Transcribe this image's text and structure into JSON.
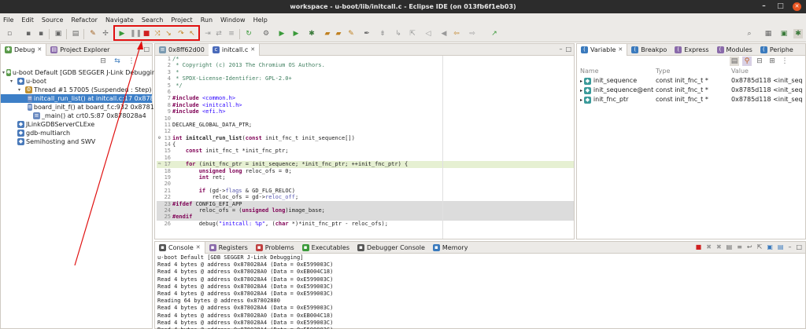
{
  "window": {
    "title": "workspace - u-boot/lib/initcall.c - Eclipse IDE  (on 013fb6f1eb03)"
  },
  "menu": [
    "File",
    "Edit",
    "Source",
    "Refactor",
    "Navigate",
    "Search",
    "Project",
    "Run",
    "Window",
    "Help"
  ],
  "debug_panel": {
    "tabs": [
      {
        "label": "Debug"
      },
      {
        "label": "Project Explorer"
      }
    ],
    "tree": [
      {
        "indent": 0,
        "icon": "launch-icon",
        "label": "u-boot Default [GDB SEGGER J-Link Debugging]"
      },
      {
        "indent": 1,
        "icon": "process-icon",
        "label": "u-boot"
      },
      {
        "indent": 2,
        "icon": "thread-icon",
        "label": "Thread #1 57005 (Suspended : Step)"
      },
      {
        "indent": 3,
        "icon": "stackframe-icon",
        "label": "initcall_run_list() at initcall.c:17 0x87828d14",
        "selected": true
      },
      {
        "indent": 3,
        "icon": "stackframe-icon",
        "label": "board_init_f() at board_f.c:932 0x87811ea"
      },
      {
        "indent": 3,
        "icon": "stackframe-icon",
        "label": "_main() at crt0.S:87 0x878028a4"
      },
      {
        "indent": 1,
        "icon": "jlink-icon",
        "label": "JLinkGDBServerCLExe"
      },
      {
        "indent": 1,
        "icon": "gdb-icon",
        "label": "gdb-multiarch"
      },
      {
        "indent": 1,
        "icon": "semihost-icon",
        "label": "Semihosting and SWV"
      }
    ]
  },
  "editor": {
    "tabs": [
      {
        "label": "0x8ff62d00"
      },
      {
        "label": "initcall.c"
      }
    ],
    "lines": [
      {
        "n": 1,
        "html": "<span class=\"cm\">/*</span>"
      },
      {
        "n": 2,
        "html": "<span class=\"cm\"> * Copyright (c) 2013 The Chromium OS Authors.</span>"
      },
      {
        "n": 3,
        "html": "<span class=\"cm\"> *</span>"
      },
      {
        "n": 4,
        "html": "<span class=\"cm\"> * SPDX-License-Identifier: GPL-2.0+</span>"
      },
      {
        "n": 5,
        "html": "<span class=\"cm\"> */</span>"
      },
      {
        "n": 6,
        "html": ""
      },
      {
        "n": 7,
        "html": "<span class=\"kw\">#include</span> <span class=\"str\">&lt;common.h&gt;</span>"
      },
      {
        "n": 8,
        "html": "<span class=\"kw\">#include</span> <span class=\"str\">&lt;initcall.h&gt;</span>"
      },
      {
        "n": 9,
        "html": "<span class=\"kw\">#include</span> <span class=\"str\">&lt;efi.h&gt;</span>"
      },
      {
        "n": 10,
        "html": ""
      },
      {
        "n": 11,
        "html": "DECLARE_GLOBAL_DATA_PTR;"
      },
      {
        "n": 12,
        "html": ""
      },
      {
        "n": 13,
        "html": "<span class=\"kw\">int</span> <b>initcall_run_list</b>(<span class=\"kw\">const</span> init_fnc_t init_sequence[])",
        "gut": "⊖"
      },
      {
        "n": 14,
        "html": "{"
      },
      {
        "n": 15,
        "html": "    <span class=\"kw\">const</span> init_fnc_t *init_fnc_ptr;"
      },
      {
        "n": 16,
        "html": ""
      },
      {
        "n": 17,
        "html": "    <span class=\"kw\">for</span> (init_fnc_ptr = init_sequence; *init_fnc_ptr; ++init_fnc_ptr) {",
        "hl": true,
        "gut": "⇨"
      },
      {
        "n": 18,
        "html": "        <span class=\"kw\">unsigned long</span> reloc_ofs = 0;"
      },
      {
        "n": 19,
        "html": "        <span class=\"kw\">int</span> ret;"
      },
      {
        "n": 20,
        "html": ""
      },
      {
        "n": 21,
        "html": "        <span class=\"kw\">if</span> (gd-&gt;<span class=\"mac\">flags</span> &amp; GD_FLG_RELOC)"
      },
      {
        "n": 22,
        "html": "            reloc_ofs = gd-&gt;<span class=\"mac\">reloc_off</span>;"
      },
      {
        "n": 23,
        "html": "<span class=\"kw\">#ifdef</span> CONFIG_EFI_APP",
        "dis": true
      },
      {
        "n": 24,
        "html": "        reloc_ofs = (<span class=\"kw\">unsigned long</span>)image_base;",
        "dis": true
      },
      {
        "n": 25,
        "html": "<span class=\"kw\">#endif</span>",
        "dis": true
      },
      {
        "n": 26,
        "html": "        debug(<span class=\"str\">\"initcall: %p\"</span>, (<span class=\"kw\">char</span> *)*init_fnc_ptr - reloc_ofs);"
      }
    ]
  },
  "variables": {
    "tabs": [
      {
        "label": "Variable"
      },
      {
        "label": "Breakpo"
      },
      {
        "label": "Express"
      },
      {
        "label": "Modules"
      },
      {
        "label": "Periphe"
      }
    ],
    "headers": [
      "Name",
      "Type",
      "Value"
    ],
    "rows": [
      {
        "name": "init_sequence",
        "type": "const init_fnc_t *",
        "value": "0x8785d118 <init_seq"
      },
      {
        "name": "init_sequence@ent",
        "type": "const init_fnc_t *",
        "value": "0x8785d118 <init_seq"
      },
      {
        "name": "init_fnc_ptr",
        "type": "const init_fnc_t *",
        "value": "0x8785d118 <init_seq"
      }
    ]
  },
  "console": {
    "tabs": [
      {
        "label": "Console"
      },
      {
        "label": "Registers"
      },
      {
        "label": "Problems"
      },
      {
        "label": "Executables"
      },
      {
        "label": "Debugger Console"
      },
      {
        "label": "Memory"
      }
    ],
    "lines": [
      "u-boot Default [GDB SEGGER J-Link Debugging]",
      "Read 4 bytes @ address 0x878028A4 (Data = 0xE599003C)",
      "Read 4 bytes @ address 0x878028A0 (Data = 0xEB004C18)",
      "Read 4 bytes @ address 0x878028A4 (Data = 0xE599003C)",
      "Read 4 bytes @ address 0x878028A4 (Data = 0xE599003C)",
      "Read 4 bytes @ address 0x878028A4 (Data = 0xE599003C)",
      "Reading 64 bytes @ address 0x87802880",
      "Read 4 bytes @ address 0x878028A4 (Data = 0xE599003C)",
      "Read 4 bytes @ address 0x878028A0 (Data = 0xEB004C18)",
      "Read 4 bytes @ address 0x878028A4 (Data = 0xE599003C)",
      "Read 4 bytes @ address 0x878028A4 (Data = 0xE599003C)"
    ]
  },
  "colors": {
    "annotation": "#e01010",
    "selection": "#3d7fc7",
    "current_line": "#e6f0d2"
  }
}
